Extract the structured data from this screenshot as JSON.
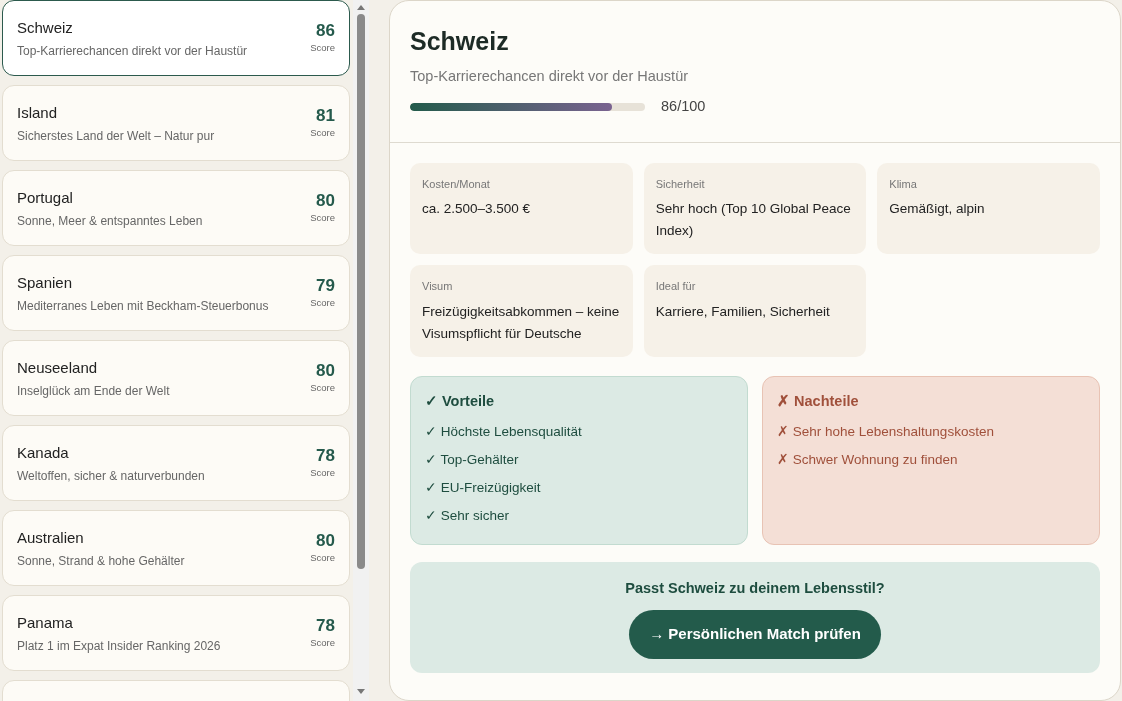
{
  "countries": [
    {
      "name": "Schweiz",
      "tagline": "Top-Karrierechancen direkt vor der Haustür",
      "score": "86",
      "score_label": "Score",
      "selected": true
    },
    {
      "name": "Island",
      "tagline": "Sicherstes Land der Welt – Natur pur",
      "score": "81",
      "score_label": "Score",
      "selected": false
    },
    {
      "name": "Portugal",
      "tagline": "Sonne, Meer & entspanntes Leben",
      "score": "80",
      "score_label": "Score",
      "selected": false
    },
    {
      "name": "Spanien",
      "tagline": "Mediterranes Leben mit Beckham-Steuerbonus",
      "score": "79",
      "score_label": "Score",
      "selected": false
    },
    {
      "name": "Neuseeland",
      "tagline": "Inselglück am Ende der Welt",
      "score": "80",
      "score_label": "Score",
      "selected": false
    },
    {
      "name": "Kanada",
      "tagline": "Weltoffen, sicher & naturverbunden",
      "score": "78",
      "score_label": "Score",
      "selected": false
    },
    {
      "name": "Australien",
      "tagline": "Sonne, Strand & hohe Gehälter",
      "score": "80",
      "score_label": "Score",
      "selected": false
    },
    {
      "name": "Panama",
      "tagline": "Platz 1 im Expat Insider Ranking 2026",
      "score": "78",
      "score_label": "Score",
      "selected": false
    }
  ],
  "detail": {
    "title": "Schweiz",
    "subtitle": "Top-Karrierechancen direkt vor der Haustür",
    "level": 0.86,
    "score_text": "86/100",
    "facts": [
      {
        "label": "Kosten/Monat",
        "value": "ca. 2.500–3.500 €"
      },
      {
        "label": "Sicherheit",
        "value": "Sehr hoch (Top 10 Global Peace Index)"
      },
      {
        "label": "Klima",
        "value": "Gemäßigt, alpin"
      },
      {
        "label": "Visum",
        "value": "Freizügigkeitsabkommen – keine Visumspflicht für Deutsche"
      },
      {
        "label": "Ideal für",
        "value": "Karriere, Familien, Sicherheit"
      }
    ],
    "pros": {
      "kind": "pro",
      "mark": "✓",
      "title": "Vorteile",
      "items": [
        {
          "mark": "✓",
          "text": "Höchste Lebensqualität"
        },
        {
          "mark": "✓",
          "text": "Top-Gehälter"
        },
        {
          "mark": "✓",
          "text": "EU-Freizügigkeit"
        },
        {
          "mark": "✓",
          "text": "Sehr sicher"
        }
      ]
    },
    "cons": {
      "kind": "con",
      "mark": "✗",
      "title": "Nachteile",
      "items": [
        {
          "mark": "✗",
          "text": "Sehr hohe Lebenshaltungskosten"
        },
        {
          "mark": "✗",
          "text": "Schwer Wohnung zu finden"
        }
      ]
    },
    "cta": {
      "question": "Passt Schweiz zu deinem Lebensstil?",
      "button": "→ Persönlichen Match prüfen"
    }
  }
}
